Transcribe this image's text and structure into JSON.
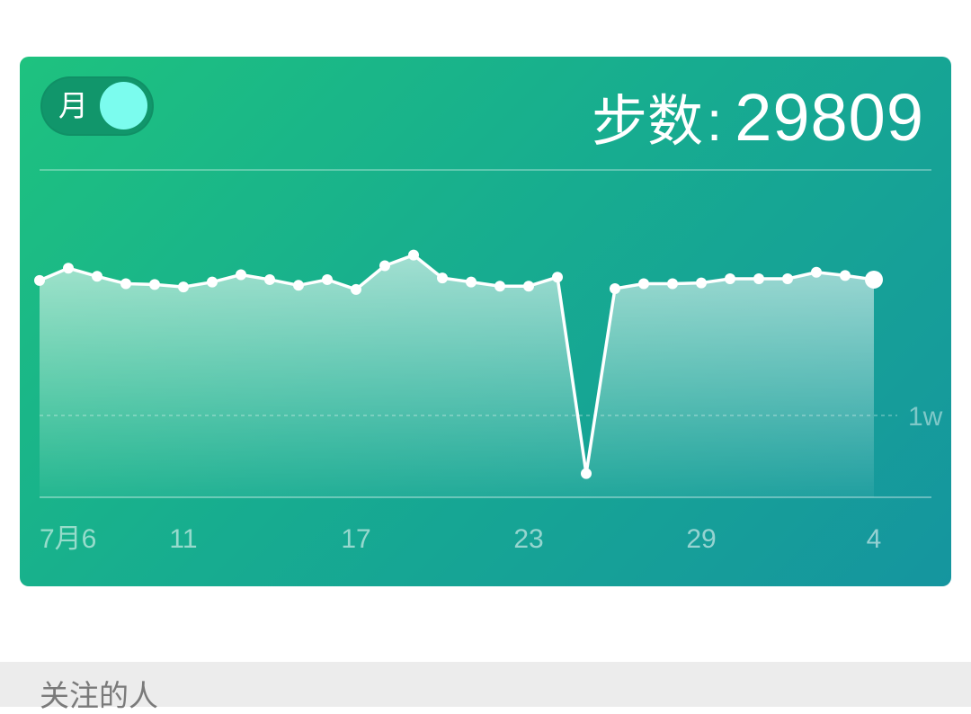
{
  "toggle": {
    "label": "月",
    "state": "on"
  },
  "steps": {
    "label": "步数",
    "colon": ":",
    "value": "29809"
  },
  "section": {
    "title": "关注的人"
  },
  "colors": {
    "accent": "#7bfcee",
    "card_start": "#1ec27f",
    "card_end": "#15959f"
  },
  "chart_data": {
    "type": "area",
    "x_tick_labels": [
      "7月6",
      "11",
      "17",
      "23",
      "29",
      "4"
    ],
    "y_reference_label": "1w",
    "y_reference_value": 10000,
    "ylim": [
      0,
      40000
    ],
    "values": [
      26500,
      28000,
      27000,
      26100,
      26000,
      25700,
      26300,
      27200,
      26600,
      25900,
      26600,
      25400,
      28300,
      29600,
      26800,
      26300,
      25800,
      25800,
      26900,
      2900,
      25500,
      26100,
      26100,
      26200,
      26700,
      26700,
      26700,
      27500,
      27100,
      26600
    ]
  }
}
